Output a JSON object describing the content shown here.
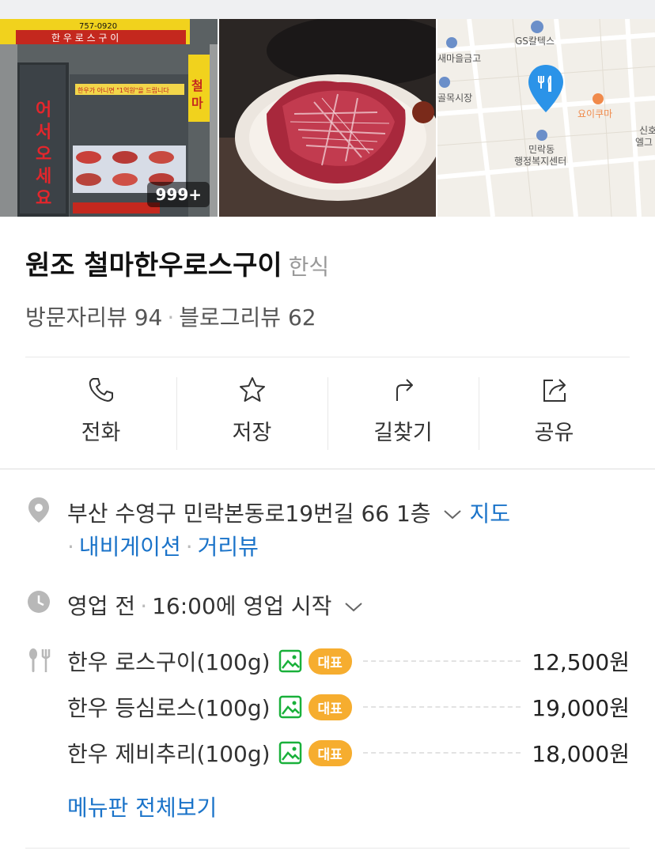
{
  "photos": {
    "sign_name": "한 우 로 스 구 이",
    "sign_phone": "757-0920",
    "window_greeting": "어서오세요",
    "window_banner": "한우가 아니면 \"1억원\"을 드립니다",
    "side_sign": "철마",
    "count_badge": "999+",
    "map_labels": {
      "gas": "GS칼텍스",
      "bank": "새마을금고",
      "market": "골목시장",
      "yoikuma": "요이쿠마",
      "office": "민락동\n행정복지센터",
      "edge1": "신호",
      "edge2": "엘그"
    }
  },
  "place": {
    "name": "원조 철마한우로스구이",
    "category": "한식",
    "visitor_reviews_label": "방문자리뷰",
    "visitor_reviews_count": "94",
    "blog_reviews_label": "블로그리뷰",
    "blog_reviews_count": "62"
  },
  "actions": [
    {
      "label": "전화",
      "icon": "phone-icon"
    },
    {
      "label": "저장",
      "icon": "star-icon"
    },
    {
      "label": "길찾기",
      "icon": "directions-icon"
    },
    {
      "label": "공유",
      "icon": "share-icon"
    }
  ],
  "address": {
    "text": "부산 수영구 민락본동로19번길 66 1층",
    "map_link": "지도",
    "navi_link": "내비게이션",
    "street_link": "거리뷰"
  },
  "hours": {
    "status": "영업 전",
    "detail": "16:00에 영업 시작"
  },
  "menu": {
    "items": [
      {
        "name": "한우 로스구이(100g)",
        "badge": "대표",
        "price": "12,500원"
      },
      {
        "name": "한우 등심로스(100g)",
        "badge": "대표",
        "price": "19,000원"
      },
      {
        "name": "한우 제비추리(100g)",
        "badge": "대표",
        "price": "18,000원"
      }
    ],
    "view_all": "메뉴판 전체보기"
  },
  "colors": {
    "link": "#1a73c9",
    "badge": "#f6ad2f",
    "image_icon": "#19b03a",
    "icon_gray": "#b8b8b8"
  }
}
